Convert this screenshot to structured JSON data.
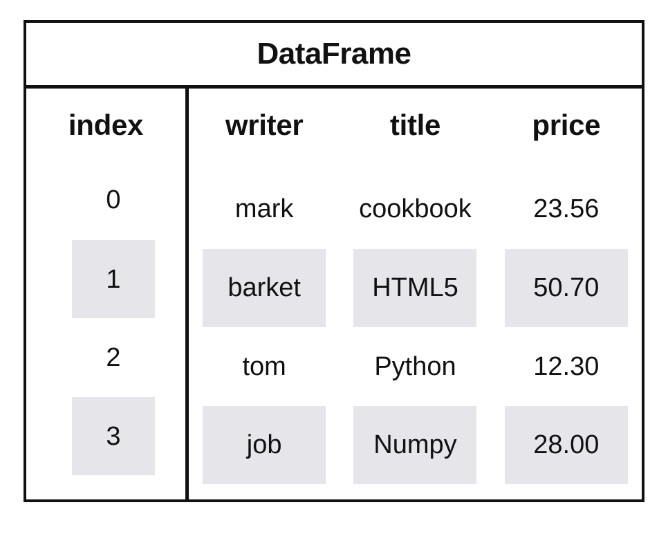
{
  "diagram": {
    "title": "DataFrame",
    "index_header": "index",
    "columns": [
      "writer",
      "title",
      "price"
    ],
    "index_values": [
      "0",
      "1",
      "2",
      "3"
    ],
    "rows": [
      {
        "index": "0",
        "writer": "mark",
        "title": "cookbook",
        "price": "23.56",
        "shaded": false
      },
      {
        "index": "1",
        "writer": "barket",
        "title": "HTML5",
        "price": "50.70",
        "shaded": true
      },
      {
        "index": "2",
        "writer": "tom",
        "title": "Python",
        "price": "12.30",
        "shaded": false
      },
      {
        "index": "3",
        "writer": "job",
        "title": "Numpy",
        "price": "28.00",
        "shaded": true
      }
    ],
    "colors": {
      "border": "#111111",
      "shaded_cell": "#e5e5ea",
      "background": "#ffffff",
      "text": "#111111"
    }
  },
  "chart_data": {
    "type": "table",
    "title": "DataFrame",
    "columns": [
      "index",
      "writer",
      "title",
      "price"
    ],
    "rows": [
      [
        "0",
        "mark",
        "cookbook",
        "23.56"
      ],
      [
        "1",
        "barket",
        "HTML5",
        "50.70"
      ],
      [
        "2",
        "tom",
        "Python",
        "12.30"
      ],
      [
        "3",
        "job",
        "Numpy",
        "28.00"
      ]
    ]
  }
}
